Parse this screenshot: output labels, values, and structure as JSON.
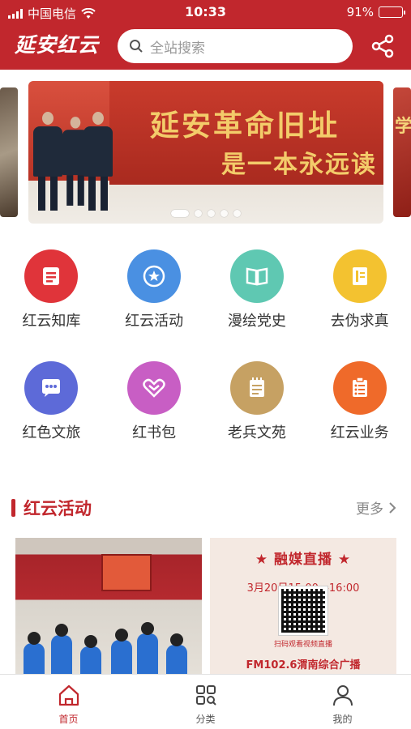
{
  "status": {
    "carrier": "中国电信",
    "time": "10:33",
    "battery": "91%",
    "battery_level": 0.91
  },
  "header": {
    "logo": "延安红云",
    "search_placeholder": "全站搜索"
  },
  "banner": {
    "headline_1": "延安革命旧址",
    "headline_2": "是一本永远读",
    "right_peek": "学",
    "slide_count": 5,
    "active_slide": 1
  },
  "menu": {
    "row1": [
      {
        "label": "红云知库",
        "icon": "book-stack-icon",
        "color": "#e0343a"
      },
      {
        "label": "红云活动",
        "icon": "badge-icon",
        "color": "#4a90e2"
      },
      {
        "label": "漫绘党史",
        "icon": "open-book-icon",
        "color": "#5fc8b2"
      },
      {
        "label": "去伪求真",
        "icon": "document-icon",
        "color": "#f3c230"
      }
    ],
    "row2": [
      {
        "label": "红色文旅",
        "icon": "chat-bubble-icon",
        "color": "#5d6ad8"
      },
      {
        "label": "红书包",
        "icon": "heart-bag-icon",
        "color": "#c85ec4"
      },
      {
        "label": "老兵文苑",
        "icon": "notepad-icon",
        "color": "#c6a163"
      },
      {
        "label": "红云业务",
        "icon": "clipboard-icon",
        "color": "#ef6a2a"
      }
    ]
  },
  "section": {
    "title": "红云活动",
    "more": "更多"
  },
  "cards": {
    "live": {
      "title": "融媒直播",
      "time": "3月20日15:00—16:00",
      "scan": "扫码观看视频直播",
      "fm": "FM102.6渭南综合广播"
    }
  },
  "tabbar": [
    {
      "label": "首页",
      "icon": "home-icon",
      "active": true
    },
    {
      "label": "分类",
      "icon": "category-grid-icon",
      "active": false
    },
    {
      "label": "我的",
      "icon": "user-icon",
      "active": false
    }
  ],
  "colors": {
    "brand": "#c1272d",
    "banner_text": "#f3cc6a"
  }
}
